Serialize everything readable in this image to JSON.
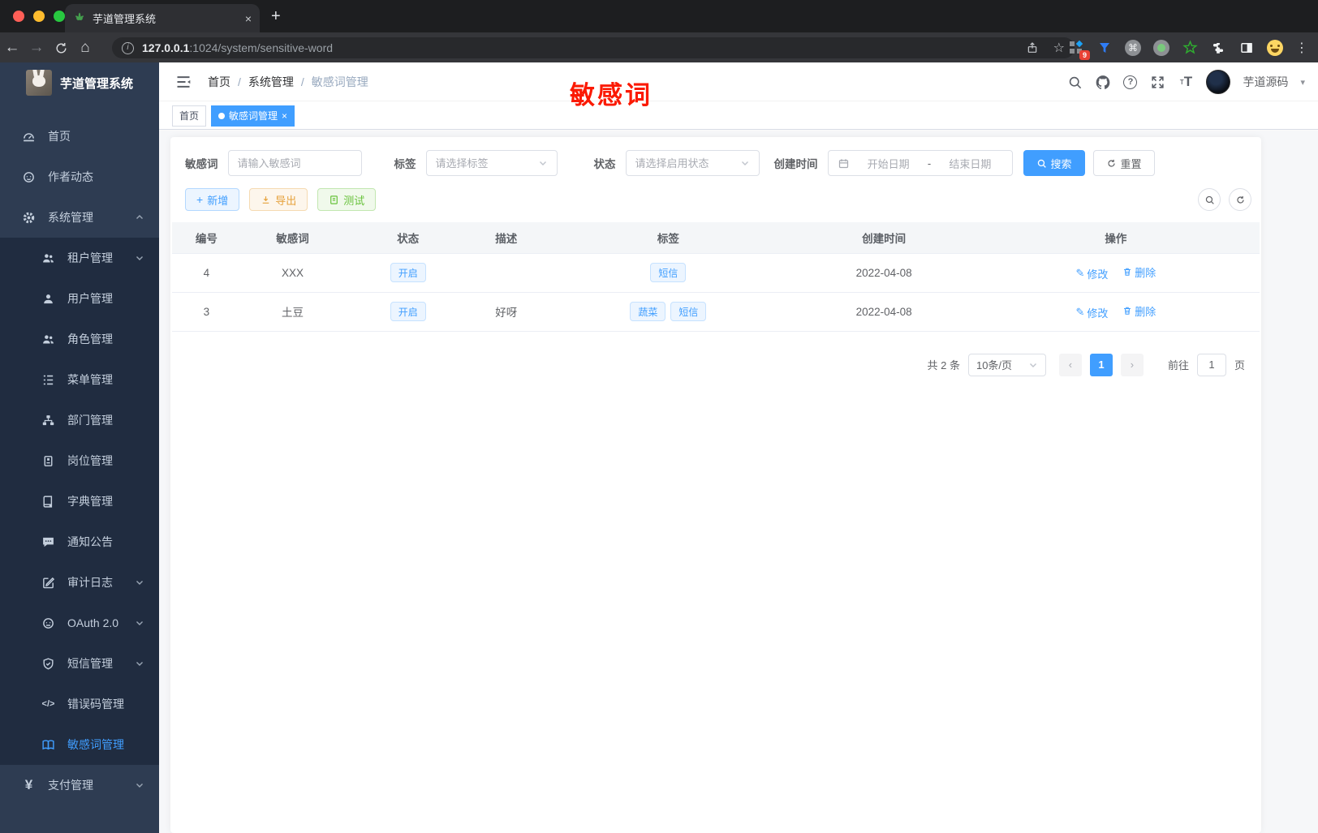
{
  "browser": {
    "tab_title": "芋道管理系统",
    "new_tab_label": "+",
    "tab_close": "×",
    "url_host": "127.0.0.1",
    "url_path": ":1024/system/sensitive-word",
    "extension_badge": "9"
  },
  "glyphs": {
    "back": "←",
    "forward": "→",
    "home": "⌂",
    "info": "i",
    "kebab": "⋮",
    "star": "☆",
    "cmd": "⌘",
    "help": "?",
    "caret_down": "▾",
    "dot": "●",
    "close": "×",
    "plus": "+",
    "code": "</>",
    "yen": "¥",
    "pencil": "✎",
    "prev": "‹",
    "next": "›",
    "font_small": "т",
    "font_big": "T",
    "date_sep": "-"
  },
  "sidebar": {
    "title": "芋道管理系统",
    "items": [
      {
        "label": "首页",
        "icon": "dashboard"
      },
      {
        "label": "作者动态",
        "icon": "author"
      },
      {
        "label": "系统管理",
        "icon": "gear",
        "chevron": "up"
      },
      {
        "label": "租户管理",
        "icon": "users",
        "chevron": "down"
      },
      {
        "label": "用户管理",
        "icon": "user"
      },
      {
        "label": "角色管理",
        "icon": "users"
      },
      {
        "label": "菜单管理",
        "icon": "menu-tree"
      },
      {
        "label": "部门管理",
        "icon": "sitemap"
      },
      {
        "label": "岗位管理",
        "icon": "badge"
      },
      {
        "label": "字典管理",
        "icon": "dictionary"
      },
      {
        "label": "通知公告",
        "icon": "announcement"
      },
      {
        "label": "审计日志",
        "icon": "audit",
        "chevron": "down"
      },
      {
        "label": "OAuth 2.0",
        "icon": "oauth",
        "chevron": "down"
      },
      {
        "label": "短信管理",
        "icon": "shield",
        "chevron": "down"
      },
      {
        "label": "错误码管理",
        "icon": "code"
      },
      {
        "label": "敏感词管理",
        "icon": "open-book",
        "active": true
      },
      {
        "label": "支付管理",
        "icon": "yen",
        "chevron": "down"
      }
    ]
  },
  "header": {
    "breadcrumb": [
      "首页",
      "系统管理",
      "敏感词管理"
    ],
    "separator": "/",
    "username": "芋道源码"
  },
  "annotation": {
    "text": "敏感词",
    "color": "#fb1a03"
  },
  "tabsbar": {
    "tabs": [
      {
        "label": "首页",
        "active": false
      },
      {
        "label": "敏感词管理",
        "active": true
      }
    ]
  },
  "filters": {
    "keyword_label": "敏感词",
    "keyword_placeholder": "请输入敏感词",
    "tag_label": "标签",
    "tag_placeholder": "请选择标签",
    "status_label": "状态",
    "status_placeholder": "请选择启用状态",
    "date_label": "创建时间",
    "date_start_placeholder": "开始日期",
    "date_separator": "-",
    "date_end_placeholder": "结束日期",
    "search_label": "搜索",
    "reset_label": "重置"
  },
  "toolbar": {
    "add_label": "新增",
    "export_label": "导出",
    "test_label": "测试"
  },
  "table": {
    "columns": [
      "编号",
      "敏感词",
      "状态",
      "描述",
      "标签",
      "创建时间",
      "操作"
    ],
    "rows": [
      {
        "id": "4",
        "word": "XXX",
        "status": "开启",
        "description": "",
        "tags": [
          "短信"
        ],
        "created_at": "2022-04-08"
      },
      {
        "id": "3",
        "word": "土豆",
        "status": "开启",
        "description": "好呀",
        "tags": [
          "蔬菜",
          "短信"
        ],
        "created_at": "2022-04-08"
      }
    ],
    "edit_label": "修改",
    "delete_label": "删除"
  },
  "pagination": {
    "total_label": "共 2 条",
    "page_size": "10条/页",
    "current_page": "1",
    "goto_label": "前往",
    "goto_value": "1",
    "unit_label": "页"
  },
  "colors": {
    "accent": "#409eff",
    "annotation_red": "#fb1a03",
    "sidebar_bg": "#2e3c52",
    "submenu_bg": "#202c40",
    "warning": "#e6a23c",
    "success": "#67c23a",
    "tab_active_bg": "#409eff"
  }
}
